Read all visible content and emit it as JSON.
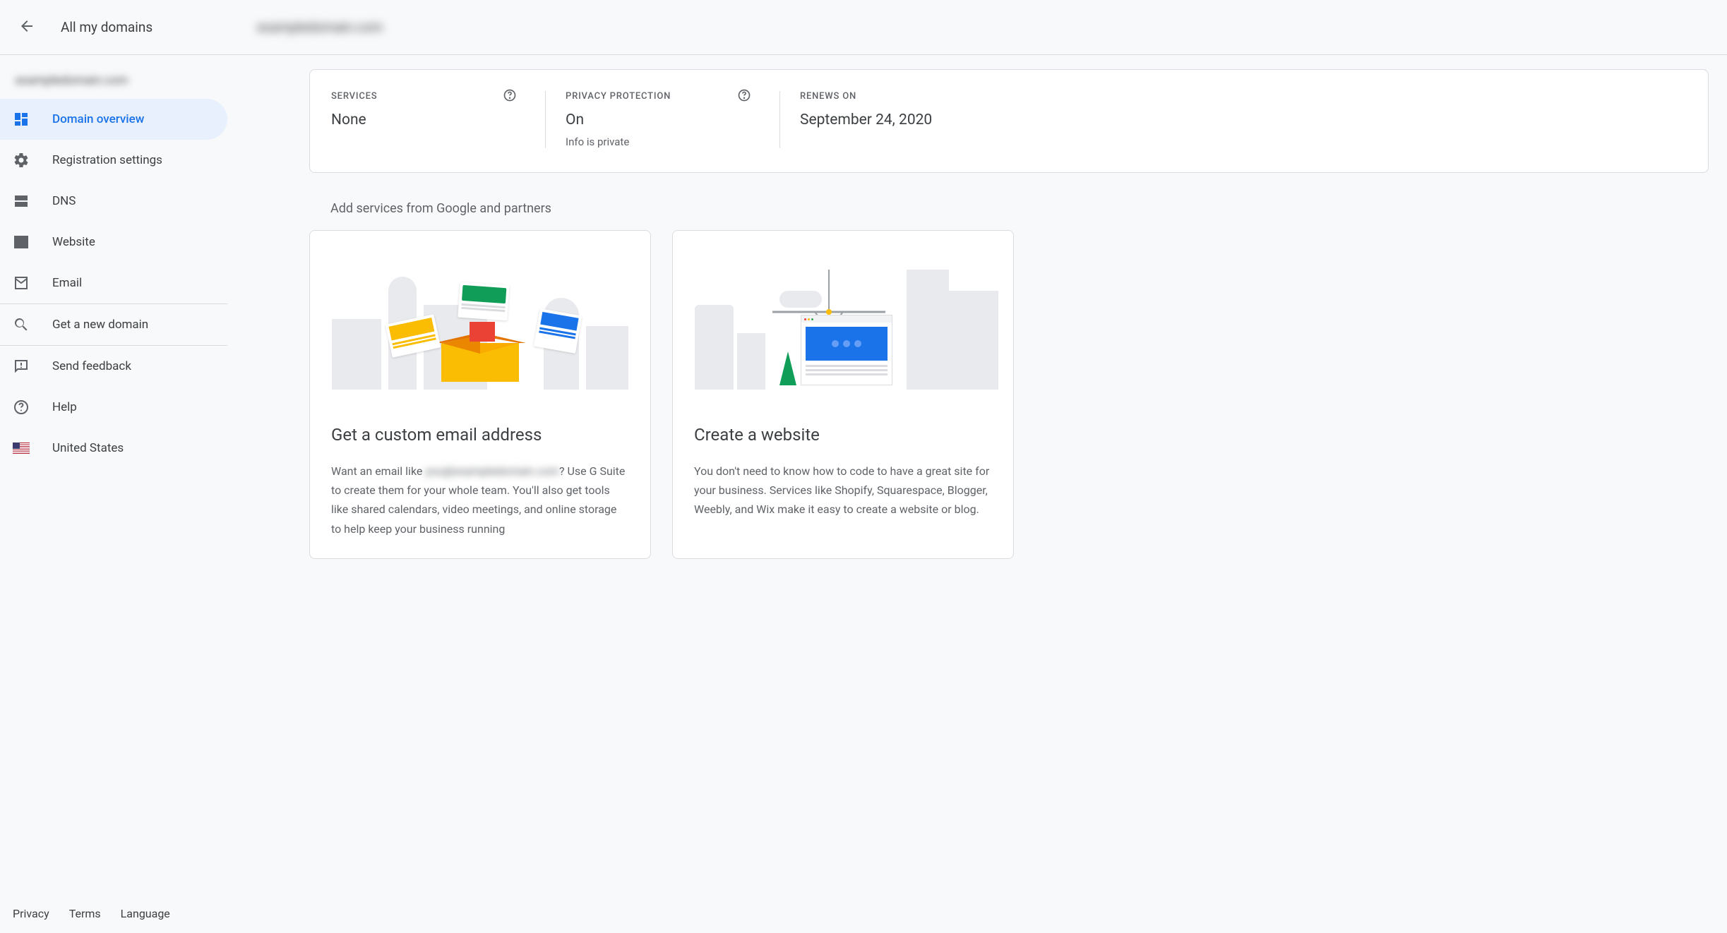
{
  "header": {
    "back_label": "All my domains",
    "domain_display": "exampledomain.com"
  },
  "sidebar": {
    "domain_display": "exampledomain.com",
    "items": [
      {
        "id": "overview",
        "label": "Domain overview",
        "active": true
      },
      {
        "id": "registration",
        "label": "Registration settings"
      },
      {
        "id": "dns",
        "label": "DNS"
      },
      {
        "id": "website",
        "label": "Website"
      },
      {
        "id": "email",
        "label": "Email"
      }
    ],
    "get_new_domain": "Get a new domain",
    "send_feedback": "Send feedback",
    "help": "Help",
    "country": "United States"
  },
  "footer": {
    "privacy": "Privacy",
    "terms": "Terms",
    "language": "Language"
  },
  "status": {
    "services": {
      "label": "SERVICES",
      "value": "None"
    },
    "privacy": {
      "label": "PRIVACY PROTECTION",
      "value": "On",
      "sub": "Info is private"
    },
    "renews": {
      "label": "RENEWS ON",
      "value": "September 24, 2020"
    }
  },
  "services_section": {
    "title": "Add services from Google and partners",
    "cards": [
      {
        "title": "Get a custom email address",
        "text_pre": "Want an email like ",
        "text_blur": "you@exampledomain.com",
        "text_post": "? Use G Suite to create them for your whole team. You'll also get tools like shared calendars, video meetings, and online storage to help keep your business running"
      },
      {
        "title": "Create a website",
        "text": "You don't need to know how to code to have a great site for your business. Services like Shopify, Squarespace, Blogger, Weebly, and Wix make it easy to create a website or blog."
      }
    ]
  }
}
